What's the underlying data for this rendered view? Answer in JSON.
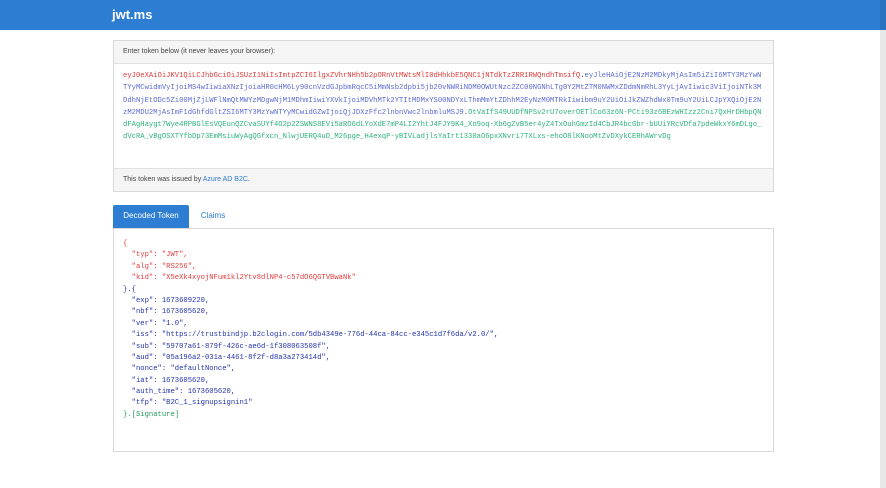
{
  "app": {
    "title": "jwt.ms"
  },
  "token": {
    "instruction": "Enter token below (it never leaves your browser):",
    "header_part": "eyJ0eXAiOiJKV1QiLCJhbGciOiJSUzI1NiIsImtpZCI6IlgxZVhrNHh5b2pORnVtMWtsMlI0dHhkbE5QNC1jNTdkTzZRR1RWQndhTmsifQ",
    "dot1": ".",
    "payload_part": "eyJleHAiOjE2NzM2MDkyMjAsIm5iZiI6MTY3MzYwNTYyMCwidmVyIjoiMS4wIiwiaXNzIjoiaHR0cHM6Ly90cnVzdGJpbmRqcC5iMmNsb2dpbi5jb20vNWRiNDM0OWUtNzc2ZC00NGNhLTg0Y2MtZTM0NWMxZDdmNmRhL3YyLjAvIiwic3ViIjoiNTk3MDdhNjEtODc5Zi00MjZjLWFlNmQtMWYzMDgwNjM1MDhmIiwiYXVkIjoiMDVhMTk2YTItMDMxYS00NDYxLThmMmYtZDhhM2EyNzM0MTRkIiwibm9uY2UiOiJkZWZhdWx0Tm9uY2UiLCJpYXQiOjE2NzM2MDU2MjAsImF1dGhfdGltZSI6MTY3MzYwNTYyMCwidGZwIjoiQjJDXzFfc2lnbnVwc2lnbmluMSJ9",
    "dot2": ".",
    "signature_part": "OtVaIfS49UUDfNPSv2rU7overOETlCo63z6N-PCti93z6BEzWHIzz2Cni7QxHrDHbpQNdFAgHaygt7Wye4RPBGlEsVQEunQZCvaSUYf4O2p2ZSWNS8EVi5aRO6dLYoXdE7mP4LI2YhtJ4FJY9K4_Xo9oq-Xb6gZvB5er4yZ4TxOuhGmzId4CbJR4bcGbr-bUUiYRcVDfa7pdeWkxY6mDLgo_dVcRA_vBgOSXTYfbDp73EmMsiuWyAgQGfxcn_NlwjUERQ4uD_M26pge_H4exqP-yBIVLadjlsYaIrt1330aO6pxXNvri7TXLxs-ehoO8lKNooMtZvDXykCERhAWrvDg"
  },
  "issuer": {
    "prefix": "This token was issued by ",
    "link": "Azure AD B2C",
    "suffix": "."
  },
  "tabs": [
    {
      "label": "Decoded Token"
    },
    {
      "label": "Claims"
    }
  ],
  "decoded": {
    "lines": [
      {
        "text": "{",
        "color": "red"
      },
      {
        "text": "  \"typ\": \"JWT\",",
        "color": "red"
      },
      {
        "text": "  \"alg\": \"RS256\",",
        "color": "red"
      },
      {
        "text": "  \"kid\": \"X5eXk4xyojNFum1kl2Ytv8dlNP4-c57dO6QGTVBwaNk\"",
        "color": "red"
      },
      {
        "text": "}.{",
        "color": "blue"
      },
      {
        "text": "  \"exp\": 1673609220,",
        "color": "blue"
      },
      {
        "text": "  \"nbf\": 1673605620,",
        "color": "blue"
      },
      {
        "text": "  \"ver\": \"1.0\",",
        "color": "blue"
      },
      {
        "text": "  \"iss\": \"https://trustbindjp.b2clogin.com/5db4349e-776d-44ca-84cc-e345c1d7f6da/v2.0/\",",
        "color": "blue"
      },
      {
        "text": "  \"sub\": \"59707a61-879f-426c-ae6d-1f308063508f\",",
        "color": "blue"
      },
      {
        "text": "  \"aud\": \"05a196a2-031a-4461-8f2f-d8a3a273414d\",",
        "color": "blue"
      },
      {
        "text": "  \"nonce\": \"defaultNonce\",",
        "color": "blue"
      },
      {
        "text": "  \"iat\": 1673605620,",
        "color": "blue"
      },
      {
        "text": "  \"auth_time\": 1673605620,",
        "color": "blue"
      },
      {
        "text": "  \"tfp\": \"B2C_1_signupsignin1\"",
        "color": "blue"
      },
      {
        "text": "}.[Signature]",
        "color": "green"
      }
    ]
  }
}
